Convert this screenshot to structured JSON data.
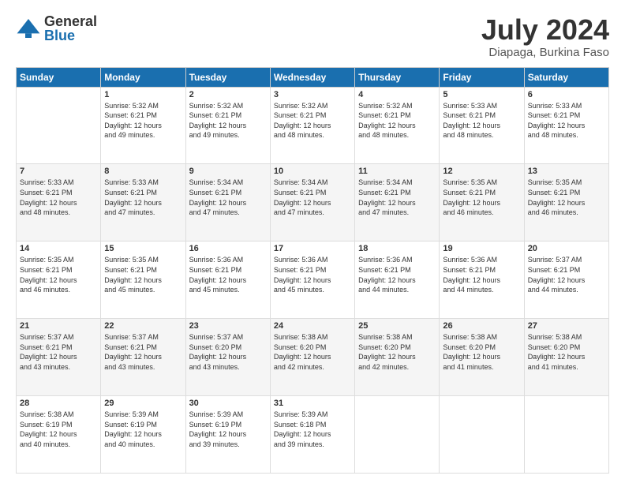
{
  "logo": {
    "general": "General",
    "blue": "Blue"
  },
  "title": "July 2024",
  "location": "Diapaga, Burkina Faso",
  "days_of_week": [
    "Sunday",
    "Monday",
    "Tuesday",
    "Wednesday",
    "Thursday",
    "Friday",
    "Saturday"
  ],
  "weeks": [
    [
      {
        "day": "",
        "info": ""
      },
      {
        "day": "1",
        "info": "Sunrise: 5:32 AM\nSunset: 6:21 PM\nDaylight: 12 hours\nand 49 minutes."
      },
      {
        "day": "2",
        "info": "Sunrise: 5:32 AM\nSunset: 6:21 PM\nDaylight: 12 hours\nand 49 minutes."
      },
      {
        "day": "3",
        "info": "Sunrise: 5:32 AM\nSunset: 6:21 PM\nDaylight: 12 hours\nand 48 minutes."
      },
      {
        "day": "4",
        "info": "Sunrise: 5:32 AM\nSunset: 6:21 PM\nDaylight: 12 hours\nand 48 minutes."
      },
      {
        "day": "5",
        "info": "Sunrise: 5:33 AM\nSunset: 6:21 PM\nDaylight: 12 hours\nand 48 minutes."
      },
      {
        "day": "6",
        "info": "Sunrise: 5:33 AM\nSunset: 6:21 PM\nDaylight: 12 hours\nand 48 minutes."
      }
    ],
    [
      {
        "day": "7",
        "info": "Sunrise: 5:33 AM\nSunset: 6:21 PM\nDaylight: 12 hours\nand 48 minutes."
      },
      {
        "day": "8",
        "info": "Sunrise: 5:33 AM\nSunset: 6:21 PM\nDaylight: 12 hours\nand 47 minutes."
      },
      {
        "day": "9",
        "info": "Sunrise: 5:34 AM\nSunset: 6:21 PM\nDaylight: 12 hours\nand 47 minutes."
      },
      {
        "day": "10",
        "info": "Sunrise: 5:34 AM\nSunset: 6:21 PM\nDaylight: 12 hours\nand 47 minutes."
      },
      {
        "day": "11",
        "info": "Sunrise: 5:34 AM\nSunset: 6:21 PM\nDaylight: 12 hours\nand 47 minutes."
      },
      {
        "day": "12",
        "info": "Sunrise: 5:35 AM\nSunset: 6:21 PM\nDaylight: 12 hours\nand 46 minutes."
      },
      {
        "day": "13",
        "info": "Sunrise: 5:35 AM\nSunset: 6:21 PM\nDaylight: 12 hours\nand 46 minutes."
      }
    ],
    [
      {
        "day": "14",
        "info": "Sunrise: 5:35 AM\nSunset: 6:21 PM\nDaylight: 12 hours\nand 46 minutes."
      },
      {
        "day": "15",
        "info": "Sunrise: 5:35 AM\nSunset: 6:21 PM\nDaylight: 12 hours\nand 45 minutes."
      },
      {
        "day": "16",
        "info": "Sunrise: 5:36 AM\nSunset: 6:21 PM\nDaylight: 12 hours\nand 45 minutes."
      },
      {
        "day": "17",
        "info": "Sunrise: 5:36 AM\nSunset: 6:21 PM\nDaylight: 12 hours\nand 45 minutes."
      },
      {
        "day": "18",
        "info": "Sunrise: 5:36 AM\nSunset: 6:21 PM\nDaylight: 12 hours\nand 44 minutes."
      },
      {
        "day": "19",
        "info": "Sunrise: 5:36 AM\nSunset: 6:21 PM\nDaylight: 12 hours\nand 44 minutes."
      },
      {
        "day": "20",
        "info": "Sunrise: 5:37 AM\nSunset: 6:21 PM\nDaylight: 12 hours\nand 44 minutes."
      }
    ],
    [
      {
        "day": "21",
        "info": "Sunrise: 5:37 AM\nSunset: 6:21 PM\nDaylight: 12 hours\nand 43 minutes."
      },
      {
        "day": "22",
        "info": "Sunrise: 5:37 AM\nSunset: 6:21 PM\nDaylight: 12 hours\nand 43 minutes."
      },
      {
        "day": "23",
        "info": "Sunrise: 5:37 AM\nSunset: 6:20 PM\nDaylight: 12 hours\nand 43 minutes."
      },
      {
        "day": "24",
        "info": "Sunrise: 5:38 AM\nSunset: 6:20 PM\nDaylight: 12 hours\nand 42 minutes."
      },
      {
        "day": "25",
        "info": "Sunrise: 5:38 AM\nSunset: 6:20 PM\nDaylight: 12 hours\nand 42 minutes."
      },
      {
        "day": "26",
        "info": "Sunrise: 5:38 AM\nSunset: 6:20 PM\nDaylight: 12 hours\nand 41 minutes."
      },
      {
        "day": "27",
        "info": "Sunrise: 5:38 AM\nSunset: 6:20 PM\nDaylight: 12 hours\nand 41 minutes."
      }
    ],
    [
      {
        "day": "28",
        "info": "Sunrise: 5:38 AM\nSunset: 6:19 PM\nDaylight: 12 hours\nand 40 minutes."
      },
      {
        "day": "29",
        "info": "Sunrise: 5:39 AM\nSunset: 6:19 PM\nDaylight: 12 hours\nand 40 minutes."
      },
      {
        "day": "30",
        "info": "Sunrise: 5:39 AM\nSunset: 6:19 PM\nDaylight: 12 hours\nand 39 minutes."
      },
      {
        "day": "31",
        "info": "Sunrise: 5:39 AM\nSunset: 6:18 PM\nDaylight: 12 hours\nand 39 minutes."
      },
      {
        "day": "",
        "info": ""
      },
      {
        "day": "",
        "info": ""
      },
      {
        "day": "",
        "info": ""
      }
    ]
  ]
}
